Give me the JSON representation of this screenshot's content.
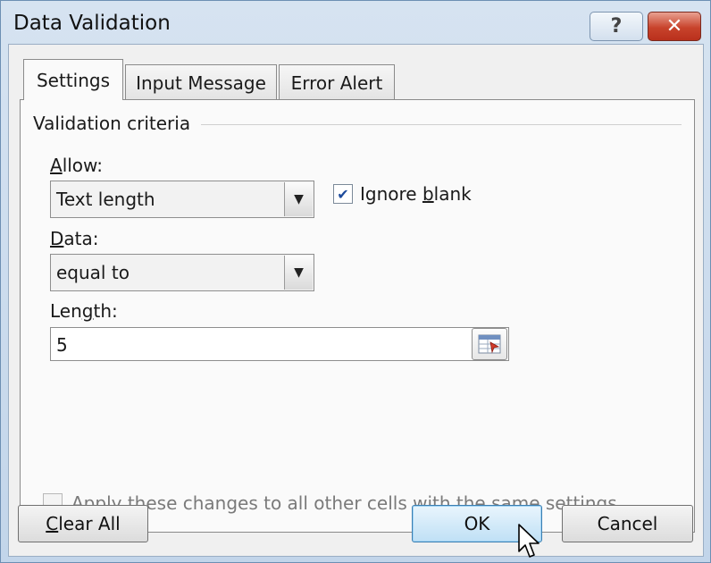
{
  "dialog": {
    "title": "Data Validation",
    "help_glyph": "?",
    "close_glyph": "✕",
    "icons": [
      "help-icon",
      "close-icon",
      "dropdown-arrow-icon",
      "checkmark-icon",
      "range-select-icon",
      "mouse-cursor-icon"
    ]
  },
  "tabs": [
    {
      "label": "Settings",
      "active": true
    },
    {
      "label": "Input Message",
      "active": false
    },
    {
      "label": "Error Alert",
      "active": false
    }
  ],
  "settings": {
    "group_label": "Validation criteria",
    "allow": {
      "label_u": "A",
      "label_rest": "llow:",
      "value": "Text length"
    },
    "ignore_blank": {
      "checked": true,
      "label_pre": "Ignore ",
      "label_u": "b",
      "label_post": "lank"
    },
    "data": {
      "label_u": "D",
      "label_rest": "ata:",
      "value": "equal to"
    },
    "length": {
      "label_pre": "Len",
      "label_u": "g",
      "label_post": "th:",
      "value": "5"
    },
    "apply_all": {
      "checked": false,
      "label": "Apply these changes to all other cells with the same settings"
    }
  },
  "buttons": {
    "clear_all_u": "C",
    "clear_all_rest": "lear All",
    "ok": "OK",
    "cancel": "Cancel"
  },
  "colors": {
    "title_bar": "#d6e3f1",
    "close_button": "#c8432c",
    "ok_button": "#bfe0f5",
    "checkmark": "#1d4b9c"
  }
}
